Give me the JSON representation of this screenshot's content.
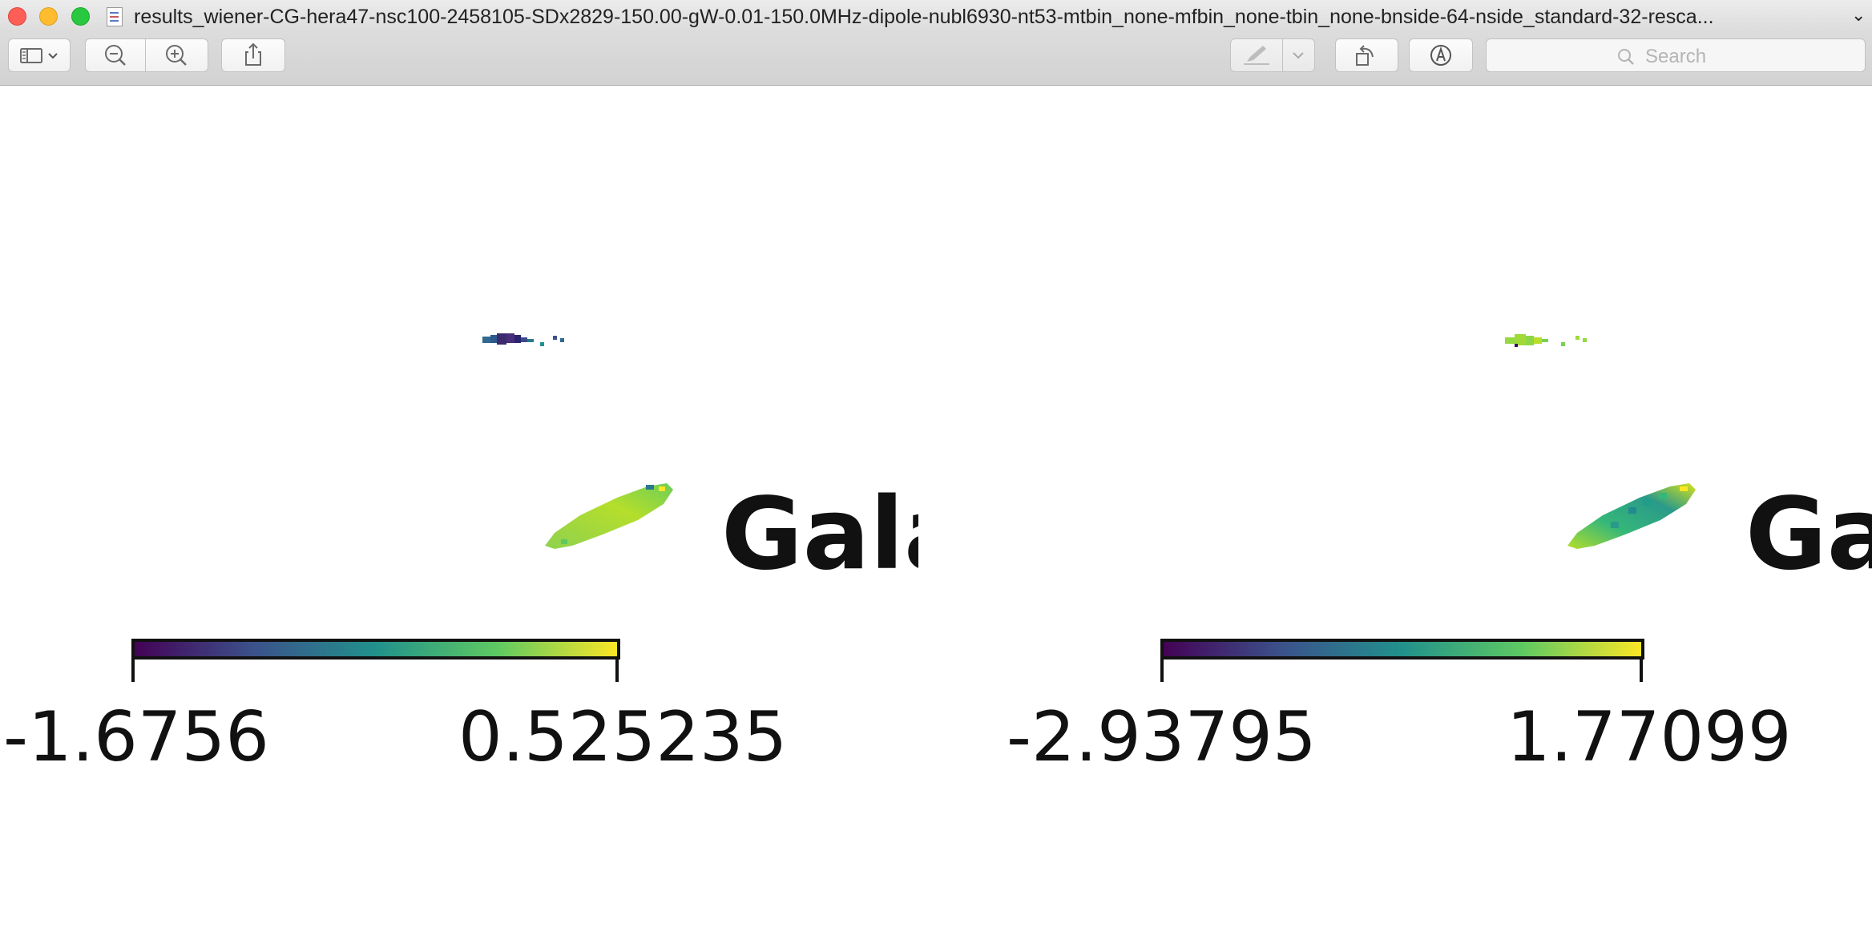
{
  "window": {
    "title": "results_wiener-CG-hera47-nsc100-2458105-SDx2829-150.00-gW-0.01-150.0MHz-dipole-nubl6930-nt53-mtbin_none-mfbin_none-tbin_none-bnside-64-nside_standard-32-resca...",
    "title_chevron": "⌄"
  },
  "toolbar": {
    "search_placeholder": "Search",
    "icons": [
      "sidebar-icon",
      "chevron-down-icon",
      "zoom-out-icon",
      "zoom-in-icon",
      "share-icon",
      "markup-pen-icon",
      "chevron-down-icon",
      "rotate-icon",
      "annotate-icon",
      "search-icon"
    ]
  },
  "panels": [
    {
      "galactic_label": "Gala",
      "colorbar": {
        "min_label": "-1.6756",
        "max_label": "0.525235",
        "colormap": "viridis"
      }
    },
    {
      "galactic_label": "Ga",
      "colorbar": {
        "min_label": "-2.93795",
        "max_label": "1.77099",
        "colormap": "viridis"
      }
    }
  ],
  "colors": {
    "viridis": [
      "#440154",
      "#3b528b",
      "#21918c",
      "#5ec962",
      "#fde725"
    ]
  }
}
